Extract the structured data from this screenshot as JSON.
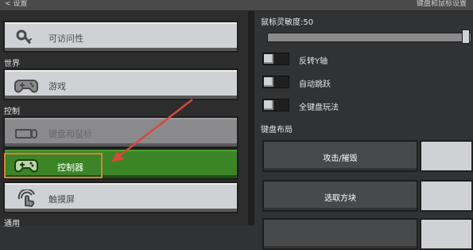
{
  "topbar": {
    "back_label": "< 设置",
    "title": "键盘和鼠标设置"
  },
  "left_panel": {
    "accessibility_label": "可访问性",
    "section_world": "世界",
    "game_label": "游戏",
    "section_controls": "控制",
    "keyboard_mouse_label": "键盘和鼠标",
    "controller_label": "控制器",
    "touch_label": "触摸屏",
    "section_general": "通用"
  },
  "right_panel": {
    "sensitivity_label": "鼠标灵敏度:50",
    "sensitivity_value": 50,
    "toggles": [
      {
        "label": "反转Y轴",
        "on": false
      },
      {
        "label": "自动跳跃",
        "on": false
      },
      {
        "label": "全键盘玩法",
        "on": false
      }
    ],
    "keyboard_layout_label": "键盘布局",
    "bindings": [
      {
        "action": "攻击/摧毁"
      },
      {
        "action": "选取方块"
      }
    ]
  },
  "colors": {
    "selected_green": "#3c8527",
    "annotation_orange": "#e07d3a",
    "annotation_arrow": "#d9473b"
  }
}
